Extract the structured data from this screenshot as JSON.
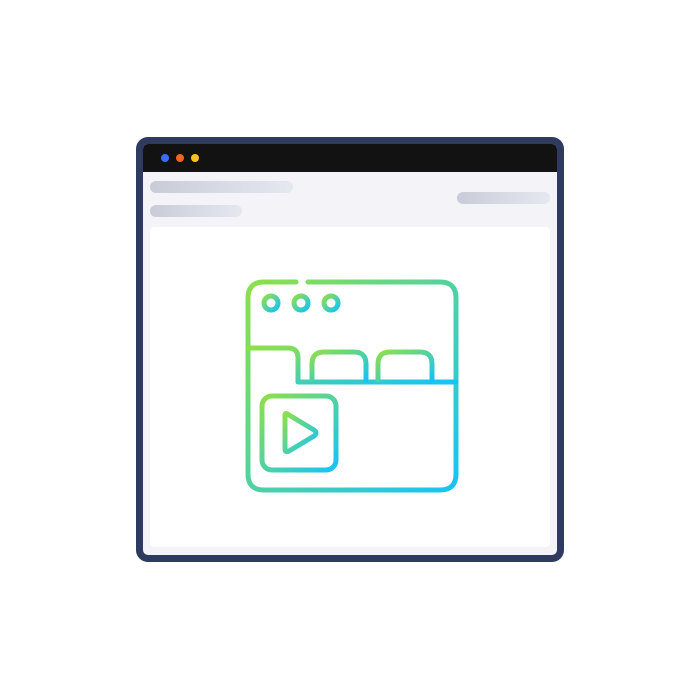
{
  "window": {
    "traffic_lights": [
      {
        "name": "blue",
        "color": "#3b6cf6"
      },
      {
        "name": "orange",
        "color": "#f2641f"
      },
      {
        "name": "yellow",
        "color": "#f6c21b"
      }
    ]
  },
  "illustration": {
    "icon": "video-web-page-icon",
    "gradient_start": "#8ee04a",
    "gradient_end": "#15c3f8"
  },
  "colors": {
    "frame": "#2e3a5e",
    "titlebar": "#121212",
    "page_bg": "#f3f3f8",
    "content_bg": "#ffffff",
    "skeleton": "#c9ccd8"
  }
}
